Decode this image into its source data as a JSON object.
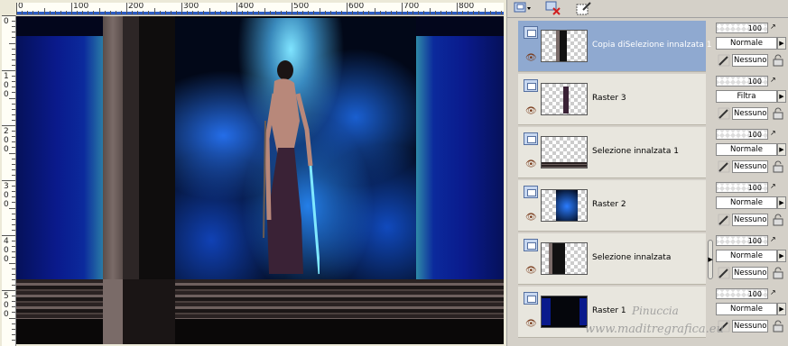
{
  "ruler": {
    "h_labels": [
      "0",
      "100",
      "200",
      "300",
      "400",
      "500",
      "600",
      "700",
      "800"
    ],
    "v_labels": [
      "0",
      "100",
      "200",
      "300",
      "400",
      "500"
    ]
  },
  "toolbar": {
    "icons": [
      "new-layer-icon",
      "delete-layer-icon",
      "layer-style-icon"
    ]
  },
  "layers": [
    {
      "name": "Copia diSelezione innalzata 1",
      "selected": true,
      "opacity": "100",
      "blend": "Normale",
      "mask": "Nessuno"
    },
    {
      "name": "Raster 3",
      "selected": false,
      "opacity": "100",
      "blend": "Filtra",
      "mask": "Nessuno"
    },
    {
      "name": "Selezione innalzata 1",
      "selected": false,
      "opacity": "100",
      "blend": "Normale",
      "mask": "Nessuno"
    },
    {
      "name": "Raster 2",
      "selected": false,
      "opacity": "100",
      "blend": "Normale",
      "mask": "Nessuno"
    },
    {
      "name": "Selezione innalzata",
      "selected": false,
      "opacity": "100",
      "blend": "Normale",
      "mask": "Nessuno"
    },
    {
      "name": "Raster 1",
      "selected": false,
      "opacity": "100",
      "blend": "Normale",
      "mask": "Nessuno"
    }
  ],
  "watermark": {
    "line1": "Pinuccia",
    "line2": "www.maditregrafica.eu"
  },
  "colors": {
    "selected_row": "#8fa9d0",
    "ruler_bar": "#2c5cc4"
  }
}
